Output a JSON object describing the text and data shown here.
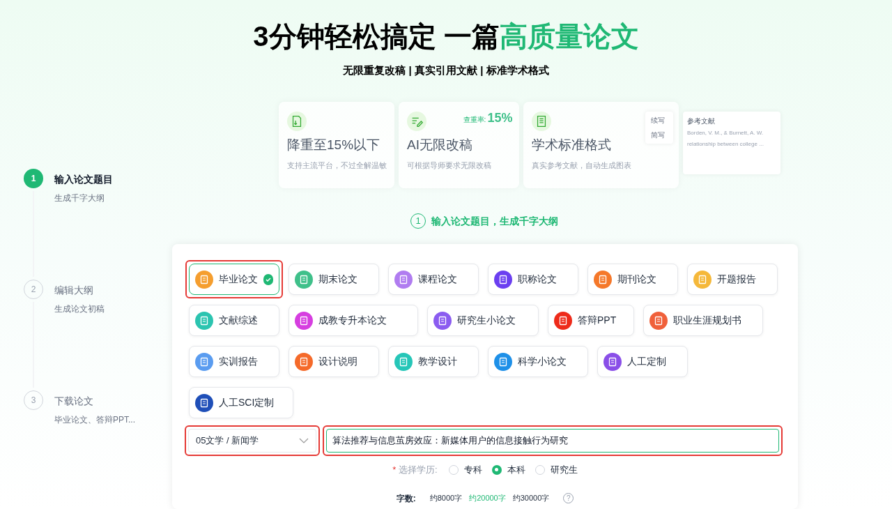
{
  "header": {
    "title_plain": "3分钟轻松搞定 一篇",
    "title_accent": "高质量论文",
    "subtitle": "无限重复改稿 | 真实引用文献 | 标准学术格式"
  },
  "features": [
    {
      "title": "降重至15%以下",
      "desc": "支持主流平台，不过全解温敏"
    },
    {
      "title": "AI无限改稿",
      "desc": "可根据导师要求无限改稿",
      "badge_label": "查重率:",
      "badge_value": "15%"
    },
    {
      "title": "学术标准格式",
      "desc": "真实参考文献，自动生成图表",
      "menu": [
        "续写",
        "简写"
      ]
    }
  ],
  "reference_card": {
    "title": "参考文献",
    "lines": [
      "Borden, V. M., & Burnett, A. W.",
      "relationship between college ..."
    ]
  },
  "steps": [
    {
      "number": "1",
      "title": "输入论文题目",
      "desc": "生成千字大纲",
      "active": true
    },
    {
      "number": "2",
      "title": "编辑大纲",
      "desc": "生成论文初稿",
      "active": false
    },
    {
      "number": "3",
      "title": "下载论文",
      "desc": "毕业论文、答辩PPT...",
      "active": false
    }
  ],
  "current_step": {
    "number": "1",
    "label": "输入论文题目，生成千字大纲"
  },
  "paper_types": [
    {
      "label": "毕业论文",
      "color": "#f59e2f",
      "selected": true,
      "highlighted": true
    },
    {
      "label": "期末论文",
      "color": "#3fc08a",
      "selected": false,
      "highlighted": false
    },
    {
      "label": "课程论文",
      "color": "#b07cf0",
      "selected": false,
      "highlighted": false
    },
    {
      "label": "职称论文",
      "color": "#6b3ff0",
      "selected": false,
      "highlighted": false
    },
    {
      "label": "期刊论文",
      "color": "#f5782a",
      "selected": false,
      "highlighted": false
    },
    {
      "label": "开题报告",
      "color": "#f5b83a",
      "selected": false,
      "highlighted": false
    },
    {
      "label": "文献综述",
      "color": "#2cc4b0",
      "selected": false,
      "highlighted": false
    },
    {
      "label": "成教专升本论文",
      "color": "#d63ee0",
      "selected": false,
      "highlighted": false
    },
    {
      "label": "研究生小论文",
      "color": "#8b5cf0",
      "selected": false,
      "highlighted": false
    },
    {
      "label": "答辩PPT",
      "color": "#ee2b1a",
      "selected": false,
      "highlighted": false
    },
    {
      "label": "职业生涯规划书",
      "color": "#f0603a",
      "selected": false,
      "highlighted": false
    },
    {
      "label": "实训报告",
      "color": "#5a9cf0",
      "selected": false,
      "highlighted": false
    },
    {
      "label": "设计说明",
      "color": "#f56a2a",
      "selected": false,
      "highlighted": false
    },
    {
      "label": "教学设计",
      "color": "#26c6b8",
      "selected": false,
      "highlighted": false
    },
    {
      "label": "科学小论文",
      "color": "#1e90e8",
      "selected": false,
      "highlighted": false
    },
    {
      "label": "人工定制",
      "color": "#8a4fe8",
      "selected": false,
      "highlighted": false
    },
    {
      "label": "人工SCI定制",
      "color": "#1f4fb8",
      "selected": false,
      "highlighted": false
    }
  ],
  "subject_select": {
    "value": "05文学 / 新闻学",
    "highlighted": true
  },
  "topic_input": {
    "value": "算法推荐与信息茧房效应：新媒体用户的信息接触行为研究",
    "highlighted": true
  },
  "education": {
    "required_mark": "*",
    "label": "选择学历:",
    "options": [
      {
        "label": "专科",
        "selected": false
      },
      {
        "label": "本科",
        "selected": true
      },
      {
        "label": "研究生",
        "selected": false
      }
    ]
  },
  "word_count": {
    "label": "字数:",
    "options": [
      {
        "label": "约8000字",
        "selected": false
      },
      {
        "label": "约20000字",
        "selected": true
      },
      {
        "label": "约30000字",
        "selected": false
      }
    ],
    "help": "?"
  }
}
